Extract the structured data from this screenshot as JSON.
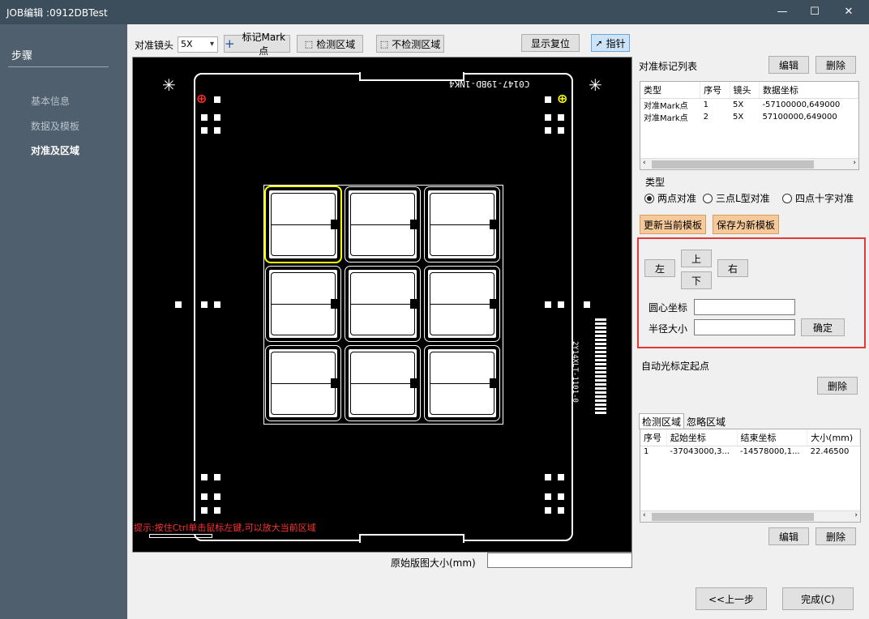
{
  "window": {
    "title": "JOB编辑 :0912DBTest",
    "minimize": "—",
    "maximize": "☐",
    "close": "✕"
  },
  "sidebar": {
    "heading": "步骤",
    "steps": [
      "基本信息",
      "数据及模板",
      "对准及区域"
    ]
  },
  "toolbar": {
    "lens_label": "对准镜头",
    "lens_value": "5X",
    "mark_btn": "标记Mark点",
    "detect_btn": "检测区域",
    "nodetect_btn": "不检测区域",
    "reset_btn": "显示复位",
    "pointer_btn": "指针"
  },
  "canvas": {
    "board_text": "C0147-19BD-1NK4",
    "side_text": "2Y14XLT-1101-0",
    "hint": "提示:按住Ctrl单击鼠标左键,可以放大当前区域",
    "size_label": "原始版图大小(mm)",
    "size_value": ""
  },
  "mark_list": {
    "title": "对准标记列表",
    "edit_btn": "编辑",
    "delete_btn": "删除",
    "columns": [
      "类型",
      "序号",
      "镜头",
      "数据坐标"
    ],
    "rows": [
      [
        "对准Mark点",
        "1",
        "5X",
        "-57100000,649000"
      ],
      [
        "对准Mark点",
        "2",
        "5X",
        "57100000,649000"
      ]
    ]
  },
  "type_group": {
    "title": "类型",
    "options": [
      "两点对准",
      "三点L型对准",
      "四点十字对准"
    ],
    "selected": 0
  },
  "template_btns": {
    "update": "更新当前模板",
    "save_new": "保存为新模板"
  },
  "move": {
    "left": "左",
    "up": "上",
    "right": "右",
    "down": "下",
    "center_label": "圆心坐标",
    "center_value": "",
    "radius_label": "半径大小",
    "radius_value": "",
    "confirm": "确定"
  },
  "auto_origin": {
    "label": "自动光标定起点",
    "delete_btn": "删除"
  },
  "regions": {
    "tabs": [
      "检测区域",
      "忽略区域"
    ],
    "columns": [
      "序号",
      "起始坐标",
      "结束坐标",
      "大小(mm)"
    ],
    "rows": [
      [
        "1",
        "-37043000,3...",
        "-14578000,1...",
        "22.46500"
      ]
    ],
    "edit_btn": "编辑",
    "delete_btn": "删除"
  },
  "footer": {
    "prev": "<<上一步",
    "finish": "完成(C)"
  },
  "icons": {
    "mark": "plus-icon",
    "region": "select-region-icon",
    "pointer": "pointer-arrow-icon"
  }
}
